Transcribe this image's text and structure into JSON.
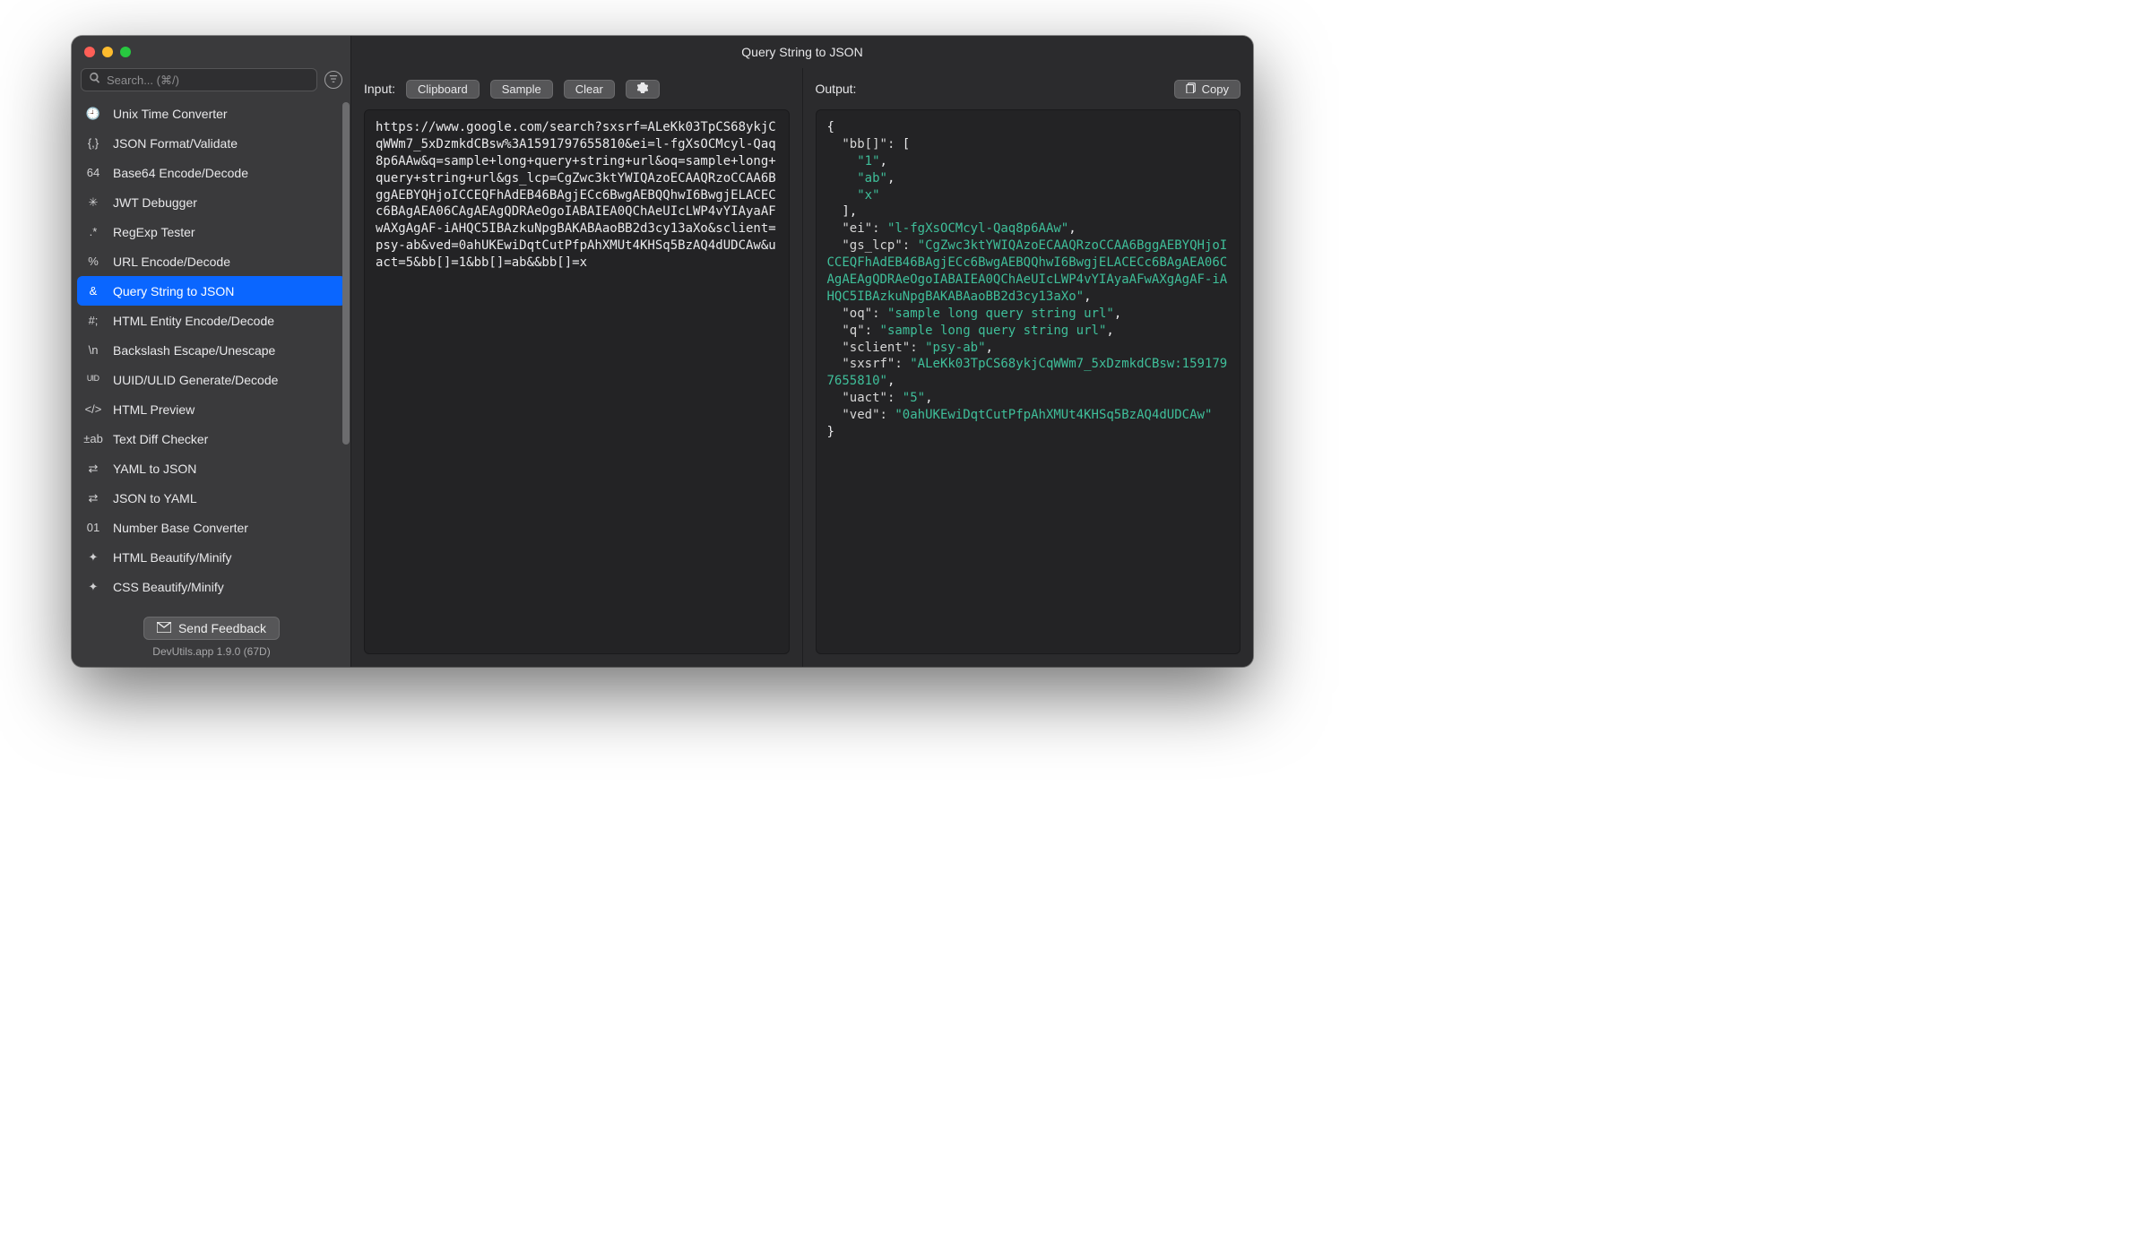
{
  "title": "Query String to JSON",
  "search": {
    "placeholder": "Search... (⌘/)"
  },
  "sidebar": {
    "items": [
      {
        "icon": "clock-icon",
        "label": "Unix Time Converter"
      },
      {
        "icon": "braces-icon",
        "label": "JSON Format/Validate"
      },
      {
        "icon": "base64-icon",
        "label": "Base64 Encode/Decode"
      },
      {
        "icon": "jwt-icon",
        "label": "JWT Debugger"
      },
      {
        "icon": "regex-icon",
        "label": "RegExp Tester"
      },
      {
        "icon": "percent-icon",
        "label": "URL Encode/Decode"
      },
      {
        "icon": "ampersand-icon",
        "label": "Query String to JSON",
        "selected": true
      },
      {
        "icon": "hash-icon",
        "label": "HTML Entity Encode/Decode"
      },
      {
        "icon": "backslash-icon",
        "label": "Backslash Escape/Unescape"
      },
      {
        "icon": "uuid-icon",
        "label": "UUID/ULID Generate/Decode"
      },
      {
        "icon": "code-icon",
        "label": "HTML Preview"
      },
      {
        "icon": "diff-icon",
        "label": "Text Diff Checker"
      },
      {
        "icon": "swap-icon",
        "label": "YAML to JSON"
      },
      {
        "icon": "swap-icon",
        "label": "JSON to YAML"
      },
      {
        "icon": "binary-icon",
        "label": "Number Base Converter"
      },
      {
        "icon": "wand-icon",
        "label": "HTML Beautify/Minify"
      },
      {
        "icon": "wand-icon",
        "label": "CSS Beautify/Minify"
      }
    ]
  },
  "feedback": {
    "label": "Send Feedback"
  },
  "version": "DevUtils.app 1.9.0 (67D)",
  "input": {
    "label": "Input:",
    "buttons": {
      "clipboard": "Clipboard",
      "sample": "Sample",
      "clear": "Clear"
    },
    "text": "https://www.google.com/search?sxsrf=ALeKk03TpCS68ykjCqWWm7_5xDzmkdCBsw%3A1591797655810&ei=l-fgXsOCMcyl-Qaq8p6AAw&q=sample+long+query+string+url&oq=sample+long+query+string+url&gs_lcp=CgZwc3ktYWIQAzoECAAQRzoCCAA6BggAEBYQHjoICCEQFhAdEB46BAgjECc6BwgAEBQQhwI6BwgjELACECc6BAgAEA06CAgAEAgQDRAeOgoIABAIEA0QChAeUIcLWP4vYIAyaAFwAXgAgAF-iAHQC5IBAzkuNpgBAKABAaoBB2d3cy13aXo&sclient=psy-ab&ved=0ahUKEwiDqtCutPfpAhXMUt4KHSq5BzAQ4dUDCAw&uact=5&bb[]=1&bb[]=ab&&bb[]=x"
  },
  "output": {
    "label": "Output:",
    "copy": "Copy",
    "json": {
      "bb[]": [
        "1",
        "ab",
        "x"
      ],
      "ei": "l-fgXsOCMcyl-Qaq8p6AAw",
      "gs_lcp": "CgZwc3ktYWIQAzoECAAQRzoCCAA6BggAEBYQHjoICCEQFhAdEB46BAgjECc6BwgAEBQQhwI6BwgjELACECc6BAgAEA06CAgAEAgQDRAeOgoIABAIEA0QChAeUIcLWP4vYIAyaAFwAXgAgAF-iAHQC5IBAzkuNpgBAKABAaoBB2d3cy13aXo",
      "oq": "sample long query string url",
      "q": "sample long query string url",
      "sclient": "psy-ab",
      "sxsrf": "ALeKk03TpCS68ykjCqWWm7_5xDzmkdCBsw:1591797655810",
      "uact": "5",
      "ved": "0ahUKEwiDqtCutPfpAhXMUt4KHSq5BzAQ4dUDCAw"
    }
  }
}
